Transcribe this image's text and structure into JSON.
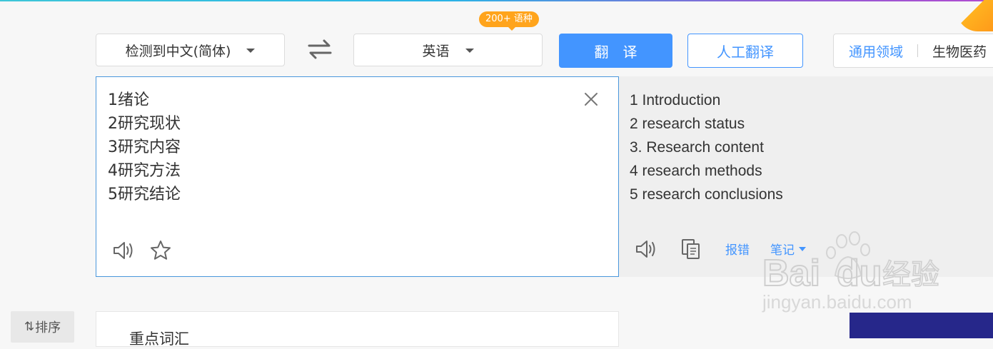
{
  "toolbar": {
    "source_language": "检测到中文(简体)",
    "target_language": "英语",
    "language_badge": "200+ 语种",
    "translate_label": "翻译",
    "human_translate_label": "人工翻译",
    "domain_general": "通用领域",
    "domain_bio": "生物医药"
  },
  "source": {
    "lines": [
      "1绪论",
      "2研究现状",
      "3研究内容",
      "4研究方法",
      "5研究结论"
    ]
  },
  "target": {
    "lines": [
      "1 Introduction",
      "2 research status",
      "3. Research content",
      "4 research methods",
      "5 research conclusions"
    ],
    "report_label": "报错",
    "notes_label": "笔记"
  },
  "sidebar": {
    "sort_icon": "⇅",
    "sort_label": "排序"
  },
  "keywords": {
    "title": "重点词汇"
  },
  "watermark": {
    "brand_en": "Bai",
    "brand_du": "du",
    "brand_cn": "经验",
    "url": "jingyan.baidu.com"
  },
  "colors": {
    "accent": "#4395ff",
    "badge": "#ffa41c",
    "source_border": "#4a97dc"
  }
}
